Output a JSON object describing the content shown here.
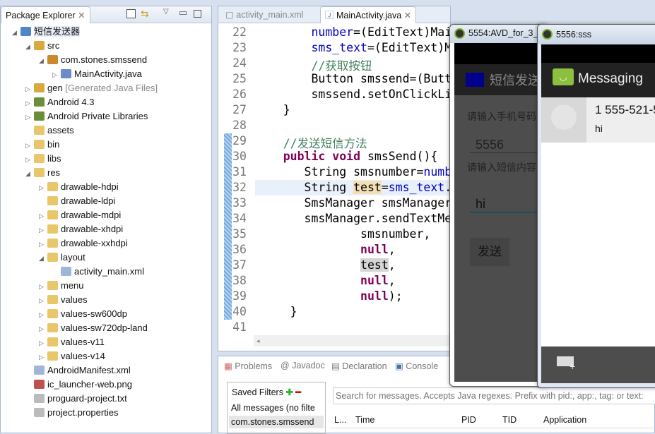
{
  "package_explorer": {
    "title": "Package Explorer",
    "tree": [
      {
        "label": "短信发送器",
        "level": 0,
        "arrow": "open",
        "icon": "project-icon",
        "color": "#4f86c6"
      },
      {
        "label": "src",
        "level": 1,
        "arrow": "open",
        "icon": "source-folder-icon",
        "color": "#d9a93d"
      },
      {
        "label": "com.stones.smssend",
        "level": 2,
        "arrow": "open",
        "icon": "package-icon",
        "color": "#c98a2c"
      },
      {
        "label": "MainActivity.java",
        "level": 3,
        "arrow": "closed",
        "icon": "java-file-icon",
        "color": "#6b8bc9"
      },
      {
        "label": "gen",
        "suffix": "[Generated Java Files]",
        "level": 1,
        "arrow": "closed",
        "icon": "source-folder-icon",
        "color": "#d9a93d"
      },
      {
        "label": "Android 4.3",
        "level": 1,
        "arrow": "closed",
        "icon": "library-icon",
        "color": "#6b8e3a"
      },
      {
        "label": "Android Private Libraries",
        "level": 1,
        "arrow": "closed",
        "icon": "library-icon",
        "color": "#6b8e3a"
      },
      {
        "label": "assets",
        "level": 1,
        "arrow": "",
        "icon": "folder-icon",
        "color": "#e8c66a"
      },
      {
        "label": "bin",
        "level": 1,
        "arrow": "closed",
        "icon": "folder-icon",
        "color": "#e8c66a"
      },
      {
        "label": "libs",
        "level": 1,
        "arrow": "closed",
        "icon": "folder-icon",
        "color": "#e8c66a"
      },
      {
        "label": "res",
        "level": 1,
        "arrow": "open",
        "icon": "folder-icon",
        "color": "#e8c66a"
      },
      {
        "label": "drawable-hdpi",
        "level": 2,
        "arrow": "closed",
        "icon": "folder-icon",
        "color": "#e8c66a"
      },
      {
        "label": "drawable-ldpi",
        "level": 2,
        "arrow": "",
        "icon": "folder-icon",
        "color": "#e8c66a"
      },
      {
        "label": "drawable-mdpi",
        "level": 2,
        "arrow": "closed",
        "icon": "folder-icon",
        "color": "#e8c66a"
      },
      {
        "label": "drawable-xhdpi",
        "level": 2,
        "arrow": "closed",
        "icon": "folder-icon",
        "color": "#e8c66a"
      },
      {
        "label": "drawable-xxhdpi",
        "level": 2,
        "arrow": "closed",
        "icon": "folder-icon",
        "color": "#e8c66a"
      },
      {
        "label": "layout",
        "level": 2,
        "arrow": "open",
        "icon": "folder-icon",
        "color": "#e8c66a"
      },
      {
        "label": "activity_main.xml",
        "level": 3,
        "arrow": "",
        "icon": "xml-file-icon",
        "color": "#9fb7d6"
      },
      {
        "label": "menu",
        "level": 2,
        "arrow": "closed",
        "icon": "folder-icon",
        "color": "#e8c66a"
      },
      {
        "label": "values",
        "level": 2,
        "arrow": "closed",
        "icon": "folder-icon",
        "color": "#e8c66a"
      },
      {
        "label": "values-sw600dp",
        "level": 2,
        "arrow": "closed",
        "icon": "folder-icon",
        "color": "#e8c66a"
      },
      {
        "label": "values-sw720dp-land",
        "level": 2,
        "arrow": "closed",
        "icon": "folder-icon",
        "color": "#e8c66a"
      },
      {
        "label": "values-v11",
        "level": 2,
        "arrow": "closed",
        "icon": "folder-icon",
        "color": "#e8c66a"
      },
      {
        "label": "values-v14",
        "level": 2,
        "arrow": "closed",
        "icon": "folder-icon",
        "color": "#e8c66a"
      },
      {
        "label": "AndroidManifest.xml",
        "level": 1,
        "arrow": "",
        "icon": "xml-file-icon",
        "color": "#9fb7d6"
      },
      {
        "label": "ic_launcher-web.png",
        "level": 1,
        "arrow": "",
        "icon": "png-file-icon",
        "color": "#c0504d"
      },
      {
        "label": "proguard-project.txt",
        "level": 1,
        "arrow": "",
        "icon": "text-file-icon",
        "color": "#bbbbbb"
      },
      {
        "label": "project.properties",
        "level": 1,
        "arrow": "",
        "icon": "text-file-icon",
        "color": "#bbbbbb"
      }
    ]
  },
  "editor": {
    "tabs": [
      {
        "label": "activity_main.xml",
        "active": false
      },
      {
        "label": "MainActivity.java",
        "active": true
      }
    ],
    "lines": [
      {
        "n": "22",
        "indent": 8,
        "html": "<span class='fld'>number</span>=(EditText)Mai"
      },
      {
        "n": "23",
        "indent": 8,
        "html": "<span class='fld'>sms_text</span>=(EditText)M"
      },
      {
        "n": "24",
        "indent": 8,
        "html": "<span class='cm'>//获取按钮</span>"
      },
      {
        "n": "25",
        "indent": 8,
        "html": "Button smssend=(Butt"
      },
      {
        "n": "26",
        "indent": 8,
        "html": "smssend.setOnClickLi"
      },
      {
        "n": "27",
        "indent": 4,
        "html": "}"
      },
      {
        "n": "28",
        "indent": 0,
        "html": ""
      },
      {
        "n": "29",
        "indent": 4,
        "html": "<span class='cm'>//发送短信方法</span>"
      },
      {
        "n": "30",
        "indent": 4,
        "html": "<span class='kw'>public</span> <span class='kw'>void</span> smsSend(){"
      },
      {
        "n": "31",
        "indent": 7,
        "html": "String smsnumber=<span class='fld'>numb</span>"
      },
      {
        "n": "32",
        "indent": 7,
        "html": "String <span class='hl'>test</span>=<span class='fld'>sms_text</span>."
      },
      {
        "n": "33",
        "indent": 7,
        "html": "SmsManager smsManager"
      },
      {
        "n": "34",
        "indent": 7,
        "html": "smsManager.sendTextMe"
      },
      {
        "n": "35",
        "indent": 15,
        "html": "smsnumber,"
      },
      {
        "n": "36",
        "indent": 15,
        "html": "<span class='kw'>null</span>,"
      },
      {
        "n": "37",
        "indent": 15,
        "html": "<span class='hl2'>test</span>,"
      },
      {
        "n": "38",
        "indent": 15,
        "html": "<span class='kw'>null</span>,"
      },
      {
        "n": "39",
        "indent": 15,
        "html": "<span class='kw'>null</span>);"
      },
      {
        "n": "40",
        "indent": 5,
        "html": "}"
      },
      {
        "n": "41",
        "indent": 0,
        "html": ""
      }
    ]
  },
  "bottom": {
    "tabs": [
      "Problems",
      "Javadoc",
      "Declaration",
      "Console"
    ],
    "saved_filters": "Saved Filters",
    "filters": [
      "All messages (no filte",
      "com.stones.smssend"
    ],
    "search_placeholder": "Search for messages. Accepts Java regexes. Prefix with pid:, app:, tag: or text:",
    "columns": [
      "L...",
      "Time",
      "PID",
      "TID",
      "Application"
    ]
  },
  "emulator1": {
    "title": "5554:AVD_for_3_",
    "app_title": "短信发送",
    "phone_label": "请输入手机号码",
    "phone_value": "5556",
    "sms_label": "请输入短信内容",
    "sms_value": "hi",
    "send_button": "发送"
  },
  "emulator2": {
    "title": "5556:sss",
    "app_title": "Messaging",
    "sender": "1 555-521-5",
    "snippet": "hi"
  }
}
